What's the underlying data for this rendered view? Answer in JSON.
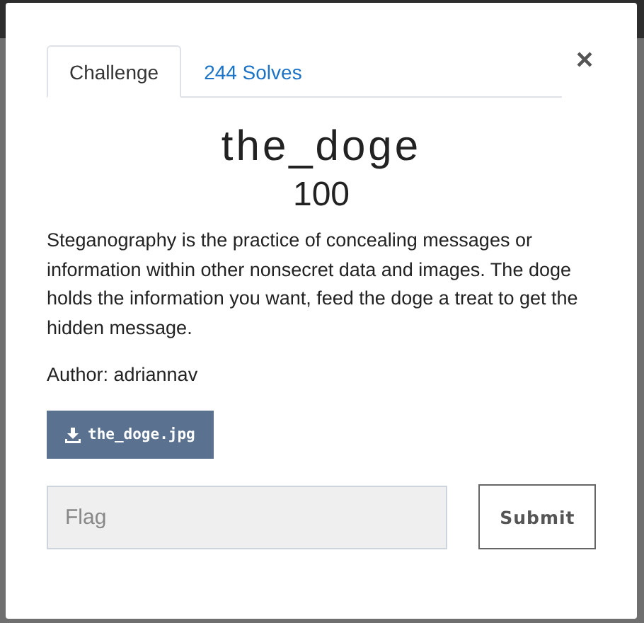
{
  "tabs": [
    {
      "label": "Challenge",
      "selected": true
    },
    {
      "label": "244 Solves",
      "selected": false
    }
  ],
  "close": "×",
  "challenge": {
    "name": "the_doge",
    "value": "100",
    "description": "Steganography is the practice of concealing messages or information within other nonsecret data and images. The doge holds the information you want, feed the doge a treat to get the hidden message.",
    "author": "Author: adriannav",
    "file": "the_doge.jpg"
  },
  "flag": {
    "placeholder": "Flag"
  },
  "submit": "Submit"
}
